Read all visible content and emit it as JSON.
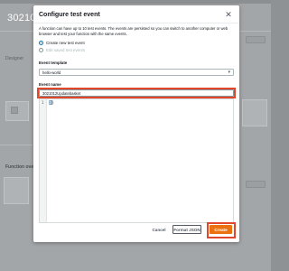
{
  "background": {
    "title": "3021012",
    "side_label": "Designer",
    "bottom_label": "Function overview"
  },
  "modal": {
    "title": "Configure test event",
    "close_icon": "close-icon",
    "description": "A function can have up to 10 test events. The events are persisted so you can switch to another computer or web browser and test your function with the same events.",
    "options": {
      "create_new": "Create new test event",
      "edit_saved": "Edit saved test events"
    },
    "event_template": {
      "label": "Event template",
      "value": "hello-world",
      "caret_icon": "caret-down-icon"
    },
    "event_name": {
      "label": "Event name",
      "value": "3021012Updatebasket"
    },
    "editor": {
      "line_number": "1",
      "code": "{}"
    },
    "buttons": {
      "cancel": "Cancel",
      "format": "Format JSON",
      "create": "Create"
    }
  },
  "colors": {
    "accent": "#ec7211",
    "highlight": "#e0472d",
    "link": "#0073bb"
  }
}
